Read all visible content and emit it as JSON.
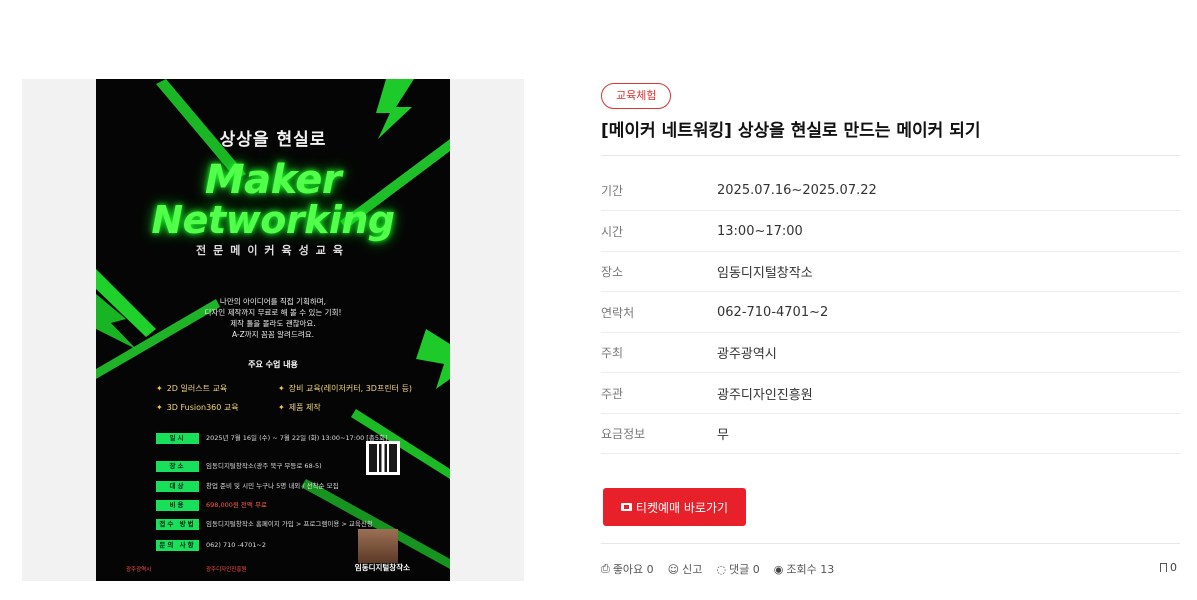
{
  "poster": {
    "subtitle": "상상을 현실로",
    "title_line1": "Maker",
    "title_line2": "Networking",
    "course_title": "전문메이커육성교육",
    "intro": [
      "나만의 아이디어를 직접 기획하며,",
      "디자인 제작까지 무료로 해 볼 수 있는 기회!",
      "제작 툴을 몰라도 괜찮아요.",
      "A-Z까지 꼼꼼 알려드려요."
    ],
    "section_label": "주요 수업 내용",
    "courses": [
      "2D 일러스트 교육",
      "장비 교육(레이저커터, 3D프린터 등)",
      "3D Fusion360 교육",
      "제품 제작"
    ],
    "info": [
      {
        "label": "일시",
        "value": "2025년 7월 16일 (수) ~ 7월 22일 (화)  13:00~17:00  [총5회]"
      },
      {
        "label": "장소",
        "value": "임동디지털창작소(광주 북구 무등로 68-5)"
      },
      {
        "label": "대상",
        "value": "창업 준비 및 시민 누구나 5명 내외 / 선착순 모집"
      },
      {
        "label": "비용",
        "value": "698,000원 전액 무료"
      },
      {
        "label": "접수 방법",
        "value": "임동디지털창작소 홈페이지 가입 > 프로그램이용 > 교육신청"
      },
      {
        "label": "문의 사항",
        "value": "062) 710 -4701~2"
      }
    ],
    "footer_org1": "광주광역시",
    "footer_org2": "광주디자인진흥원",
    "footer_venue": "임동디지털창작소"
  },
  "detail": {
    "badge": "교육체험",
    "title": "[메이커 네트워킹] 상상을 현실로 만드는 메이커 되기",
    "rows": [
      {
        "key": "기간",
        "value": "2025.07.16~2025.07.22"
      },
      {
        "key": "시간",
        "value": "13:00~17:00"
      },
      {
        "key": "장소",
        "value": "임동디지털창작소"
      },
      {
        "key": "연락처",
        "value": "062-710-4701~2"
      },
      {
        "key": "주최",
        "value": "광주광역시"
      },
      {
        "key": "주관",
        "value": "광주디자인진흥원"
      },
      {
        "key": "요금정보",
        "value": "무"
      }
    ],
    "ticket_button": "티켓예매 바로가기",
    "actions": {
      "like": "좋아요 0",
      "report": "신고",
      "comment": "댓글 0",
      "views": "조회수 13",
      "bookmark": "0"
    }
  },
  "colors": {
    "accent": "#e8202a",
    "neon": "#52ff4a"
  }
}
